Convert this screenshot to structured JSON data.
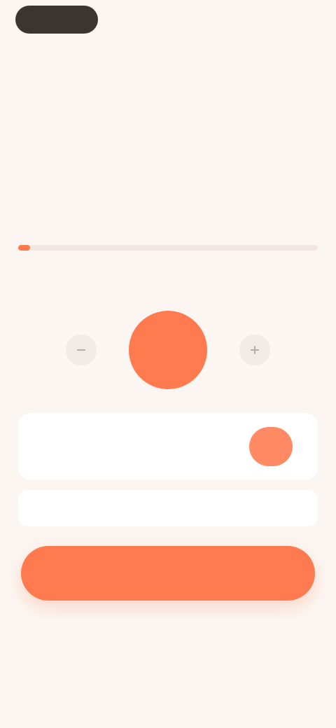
{
  "header": {
    "back_label": "",
    "right_action": "",
    "title": ""
  },
  "intro": {
    "eyebrow": "",
    "headline": "",
    "subtext": ""
  },
  "progress": {
    "value_fraction": 0.04,
    "start_label": "",
    "end_label": ""
  },
  "stepper": {
    "value": "",
    "minus_icon": "minus-icon",
    "plus_icon": "plus-icon"
  },
  "option_card": {
    "label": "",
    "toggle_on": true
  },
  "secondary": {
    "link_label": ""
  },
  "primary": {
    "button_label": ""
  },
  "colors": {
    "accent": "#ff7a4e",
    "background": "#fbf6f2",
    "card": "#ffffff",
    "dark_pill": "#3a3531"
  }
}
